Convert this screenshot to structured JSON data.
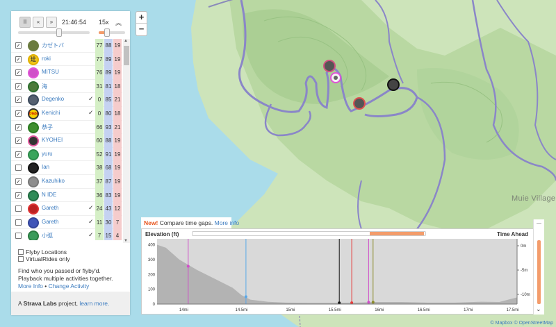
{
  "zoom": {
    "in": "+",
    "out": "−"
  },
  "map": {
    "place_label": "Muie Village",
    "attribution": "© Mapbox © OpenStreetMap"
  },
  "player": {
    "clock": "21:46:54",
    "speed": "15x",
    "pause_icon": "II",
    "back_icon": "«",
    "forward_icon": "»",
    "collapse_icon": "︽",
    "timeline_position": 0.58,
    "speed_position": 0.25
  },
  "athletes": [
    {
      "name": "カゼトバ",
      "checked": true,
      "flyby": false,
      "v1": "77",
      "v2": "88",
      "v3": "19",
      "color": "#6b7b3f",
      "ring": "#6b7b3f"
    },
    {
      "name": "roki",
      "checked": true,
      "flyby": false,
      "v1": "77",
      "v2": "89",
      "v3": "19",
      "color": "#f0c419",
      "ring": "#e0b000",
      "text": "辻"
    },
    {
      "name": "MITSU",
      "checked": true,
      "flyby": false,
      "v1": "76",
      "v2": "89",
      "v3": "19",
      "color": "#d04fc9",
      "ring": "#e055d6"
    },
    {
      "name": "海",
      "checked": true,
      "flyby": false,
      "v1": "31",
      "v2": "81",
      "v3": "18",
      "color": "#4c7a3a",
      "ring": "#2d6e2d"
    },
    {
      "name": "Degenko",
      "checked": true,
      "flyby": true,
      "v1": "0",
      "v2": "85",
      "v3": "21",
      "color": "#556070",
      "ring": "#3c4a5c"
    },
    {
      "name": "Kenichi",
      "checked": true,
      "flyby": true,
      "v1": "0",
      "v2": "80",
      "v3": "18",
      "color": "#f5d100",
      "ring": "#333",
      "text": "Diablo"
    },
    {
      "name": "恭子",
      "checked": true,
      "flyby": false,
      "v1": "66",
      "v2": "93",
      "v3": "21",
      "color": "#3e8e2e",
      "ring": "#2a7a20"
    },
    {
      "name": "KYOHEI",
      "checked": true,
      "flyby": false,
      "v1": "60",
      "v2": "88",
      "v3": "19",
      "color": "#333",
      "ring": "#e0559c"
    },
    {
      "name": "yuru",
      "checked": true,
      "flyby": false,
      "v1": "52",
      "v2": "91",
      "v3": "19",
      "color": "#3aa55c",
      "ring": "#2d8a4a"
    },
    {
      "name": "Ian",
      "checked": false,
      "flyby": false,
      "v1": "38",
      "v2": "68",
      "v3": "19",
      "color": "#222",
      "ring": "#111"
    },
    {
      "name": "Kazuhiko",
      "checked": true,
      "flyby": false,
      "v1": "37",
      "v2": "87",
      "v3": "19",
      "color": "#8d8d8d",
      "ring": "#777"
    },
    {
      "name": "N IDE",
      "checked": true,
      "flyby": false,
      "v1": "36",
      "v2": "83",
      "v3": "19",
      "color": "#2e8b57",
      "ring": "#206a40"
    },
    {
      "name": "Gareth",
      "checked": false,
      "flyby": true,
      "v1": "24",
      "v2": "43",
      "v3": "12",
      "color": "#b22",
      "ring": "#d33"
    },
    {
      "name": "Gareth",
      "checked": false,
      "flyby": true,
      "v1": "11",
      "v2": "30",
      "v3": "7",
      "color": "#4055b8",
      "ring": "#334499"
    },
    {
      "name": "小弧",
      "checked": false,
      "flyby": true,
      "v1": "7",
      "v2": "15",
      "v3": "4",
      "color": "#3a9b5a",
      "ring": "#2a7a40"
    }
  ],
  "options": {
    "flyby_locations": "Flyby Locations",
    "virtual_rides": "VirtualRides only",
    "description": "Find who you passed or flyby'd. Playback multiple activities together.",
    "more_info": "More Info",
    "bullet": "•",
    "change_activity": "Change Activity"
  },
  "footer": {
    "prefix": "A",
    "brand": "Strava Labs",
    "middle": "project,",
    "learn_more": "learn more."
  },
  "newbar": {
    "badge": "New!",
    "text": "Compare time gaps.",
    "link": "More info"
  },
  "elevation_panel": {
    "elevation_label": "Elevation (ft)",
    "time_label": "Time Ahead",
    "close_icon": "—",
    "scroll_down_icon": "⌄",
    "time_ahead_ticks": [
      {
        "label": "0m",
        "value": 0
      },
      {
        "label": "-5m",
        "value": -5
      },
      {
        "label": "-10m",
        "value": -10
      }
    ]
  },
  "chart_data": {
    "type": "area",
    "xlabel": "",
    "ylabel": "Elevation (ft)",
    "x_ticks": [
      "14mi",
      "14.5mi",
      "15mi",
      "15.5mi",
      "16mi",
      "16.5mi",
      "17mi",
      "17.5mi"
    ],
    "x_tick_values": [
      13.85,
      14.5,
      15.05,
      15.55,
      16.05,
      16.55,
      17.05,
      17.55
    ],
    "y_ticks": [
      0,
      100,
      200,
      300,
      400
    ],
    "xlim": [
      13.55,
      17.6
    ],
    "ylim": [
      0,
      440
    ],
    "series": [
      {
        "values": [
          [
            13.55,
            400
          ],
          [
            13.65,
            380
          ],
          [
            13.8,
            300
          ],
          [
            14.0,
            230
          ],
          [
            14.2,
            170
          ],
          [
            14.4,
            110
          ],
          [
            14.5,
            60
          ],
          [
            14.6,
            30
          ],
          [
            14.8,
            15
          ],
          [
            15.0,
            10
          ],
          [
            15.3,
            8
          ],
          [
            15.5,
            8
          ],
          [
            15.8,
            10
          ],
          [
            16.0,
            14
          ],
          [
            16.3,
            14
          ],
          [
            16.6,
            10
          ],
          [
            16.9,
            10
          ],
          [
            17.2,
            16
          ],
          [
            17.4,
            14
          ],
          [
            17.5,
            30
          ],
          [
            17.6,
            45
          ]
        ]
      }
    ],
    "markers": [
      {
        "x": 13.9,
        "y": 255,
        "color": "#d04fc9"
      },
      {
        "x": 14.55,
        "y": 50,
        "color": "#5aa8e8"
      },
      {
        "x": 15.6,
        "y": 8,
        "color": "#111111"
      },
      {
        "x": 15.74,
        "y": 9,
        "color": "#e83b3b"
      },
      {
        "x": 15.93,
        "y": 12,
        "color": "#d04fc9"
      },
      {
        "x": 15.98,
        "y": 13,
        "color": "#8a8a2a"
      }
    ]
  }
}
